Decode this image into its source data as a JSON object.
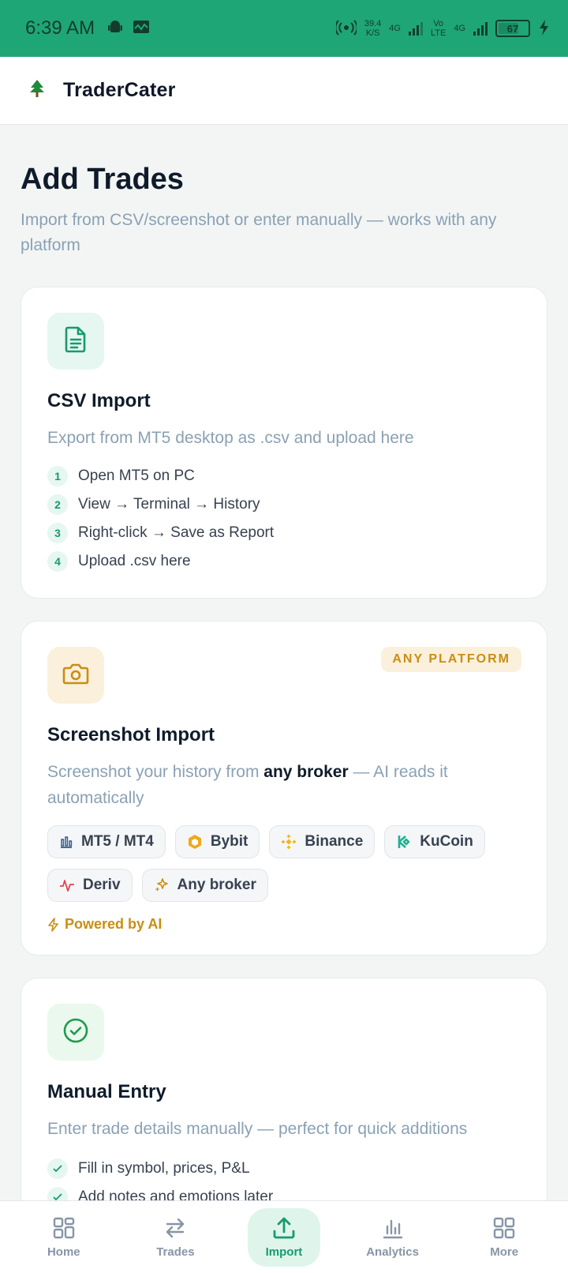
{
  "status_bar": {
    "time": "6:39 AM",
    "net_speed_value": "39.4",
    "net_speed_unit": "K/S",
    "net_type_1": "4G",
    "volte_1": "Vo",
    "volte_2": "LTE",
    "net_type_2": "4G",
    "battery": "67"
  },
  "app": {
    "name": "TraderCater"
  },
  "page": {
    "title": "Add Trades",
    "subtitle": "Import from CSV/screenshot or enter manually — works with any platform"
  },
  "csv_card": {
    "title": "CSV Import",
    "description": "Export from MT5 desktop as .csv and upload here",
    "steps": [
      {
        "num": "1",
        "text": "Open MT5 on PC"
      },
      {
        "num": "2",
        "text": "View → Terminal → History"
      },
      {
        "num": "3",
        "text": "Right-click → Save as Report"
      },
      {
        "num": "4",
        "text": "Upload .csv here"
      }
    ]
  },
  "screenshot_card": {
    "badge": "ANY PLATFORM",
    "title": "Screenshot Import",
    "description_pre": "Screenshot your history from ",
    "description_bold": "any broker",
    "description_post": " — AI reads it automatically",
    "brokers": [
      {
        "label": "MT5 / MT4",
        "icon": "chart-bars-icon"
      },
      {
        "label": "Bybit",
        "icon": "bybit-hexagon-icon"
      },
      {
        "label": "Binance",
        "icon": "binance-diamond-icon"
      },
      {
        "label": "KuCoin",
        "icon": "kucoin-icon"
      },
      {
        "label": "Deriv",
        "icon": "pulse-icon"
      },
      {
        "label": "Any broker",
        "icon": "sparkles-icon"
      }
    ],
    "powered_by": "Powered by AI"
  },
  "manual_card": {
    "title": "Manual Entry",
    "description": "Enter trade details manually — perfect for quick additions",
    "features": [
      "Fill in symbol, prices, P&L",
      "Add notes and emotions later"
    ]
  },
  "bottom_nav": {
    "items": [
      {
        "label": "Home",
        "icon": "grid-icon"
      },
      {
        "label": "Trades",
        "icon": "swap-arrows-icon"
      },
      {
        "label": "Import",
        "icon": "upload-icon"
      },
      {
        "label": "Analytics",
        "icon": "bar-chart-icon"
      },
      {
        "label": "More",
        "icon": "more-grid-icon"
      }
    ],
    "active": "Import"
  },
  "colors": {
    "status_bar": "#1fa676",
    "accent_green": "#169b6e",
    "accent_amber": "#c98e13",
    "muted_text": "#8aa1b4"
  }
}
